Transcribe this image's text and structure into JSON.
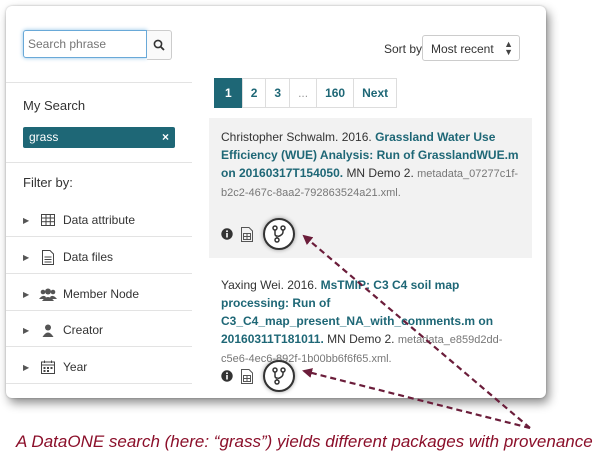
{
  "search": {
    "placeholder": "Search phrase",
    "button_icon": "magnifier-icon"
  },
  "sidebar": {
    "my_search_title": "My Search",
    "chip_text": "grass",
    "chip_close": "×",
    "filter_title": "Filter by:",
    "filters": [
      {
        "label": "Data attribute",
        "icon": "table-icon"
      },
      {
        "label": "Data files",
        "icon": "file-icon"
      },
      {
        "label": "Member Node",
        "icon": "users-icon"
      },
      {
        "label": "Creator",
        "icon": "user-icon"
      },
      {
        "label": "Year",
        "icon": "calendar-icon"
      }
    ]
  },
  "sort": {
    "label": "Sort by",
    "value": "Most recent"
  },
  "pagination": {
    "pages": [
      "1",
      "2",
      "3",
      "...",
      "160",
      "Next"
    ],
    "active": "1"
  },
  "results": [
    {
      "author_year": "Christopher Schwalm. 2016.",
      "title": "Grassland Water Use Efficiency (WUE) Analysis: Run of GrasslandWUE.m on 20160317T154050.",
      "repo": "MN Demo 2.",
      "metadata": "metadata_07277c1f-b2c2-467c-8aa2-792863524a21.xml."
    },
    {
      "author_year": "Yaxing Wei. 2016.",
      "title": "MsTMIP: C3 C4 soil map processing: Run of C3_C4_map_present_NA_with_comments.m on 20160311T181011.",
      "repo": "MN Demo 2.",
      "metadata": "metadata_e859d2dd-c5e6-4ec6-892f-1b00bb6f6f65.xml."
    }
  ],
  "caption": "A DataONE search (here: “grass”) yields different packages with provenance",
  "colors": {
    "accent": "#1e6776",
    "caption": "#8b0f2a",
    "arrow": "#6b1d3a"
  }
}
